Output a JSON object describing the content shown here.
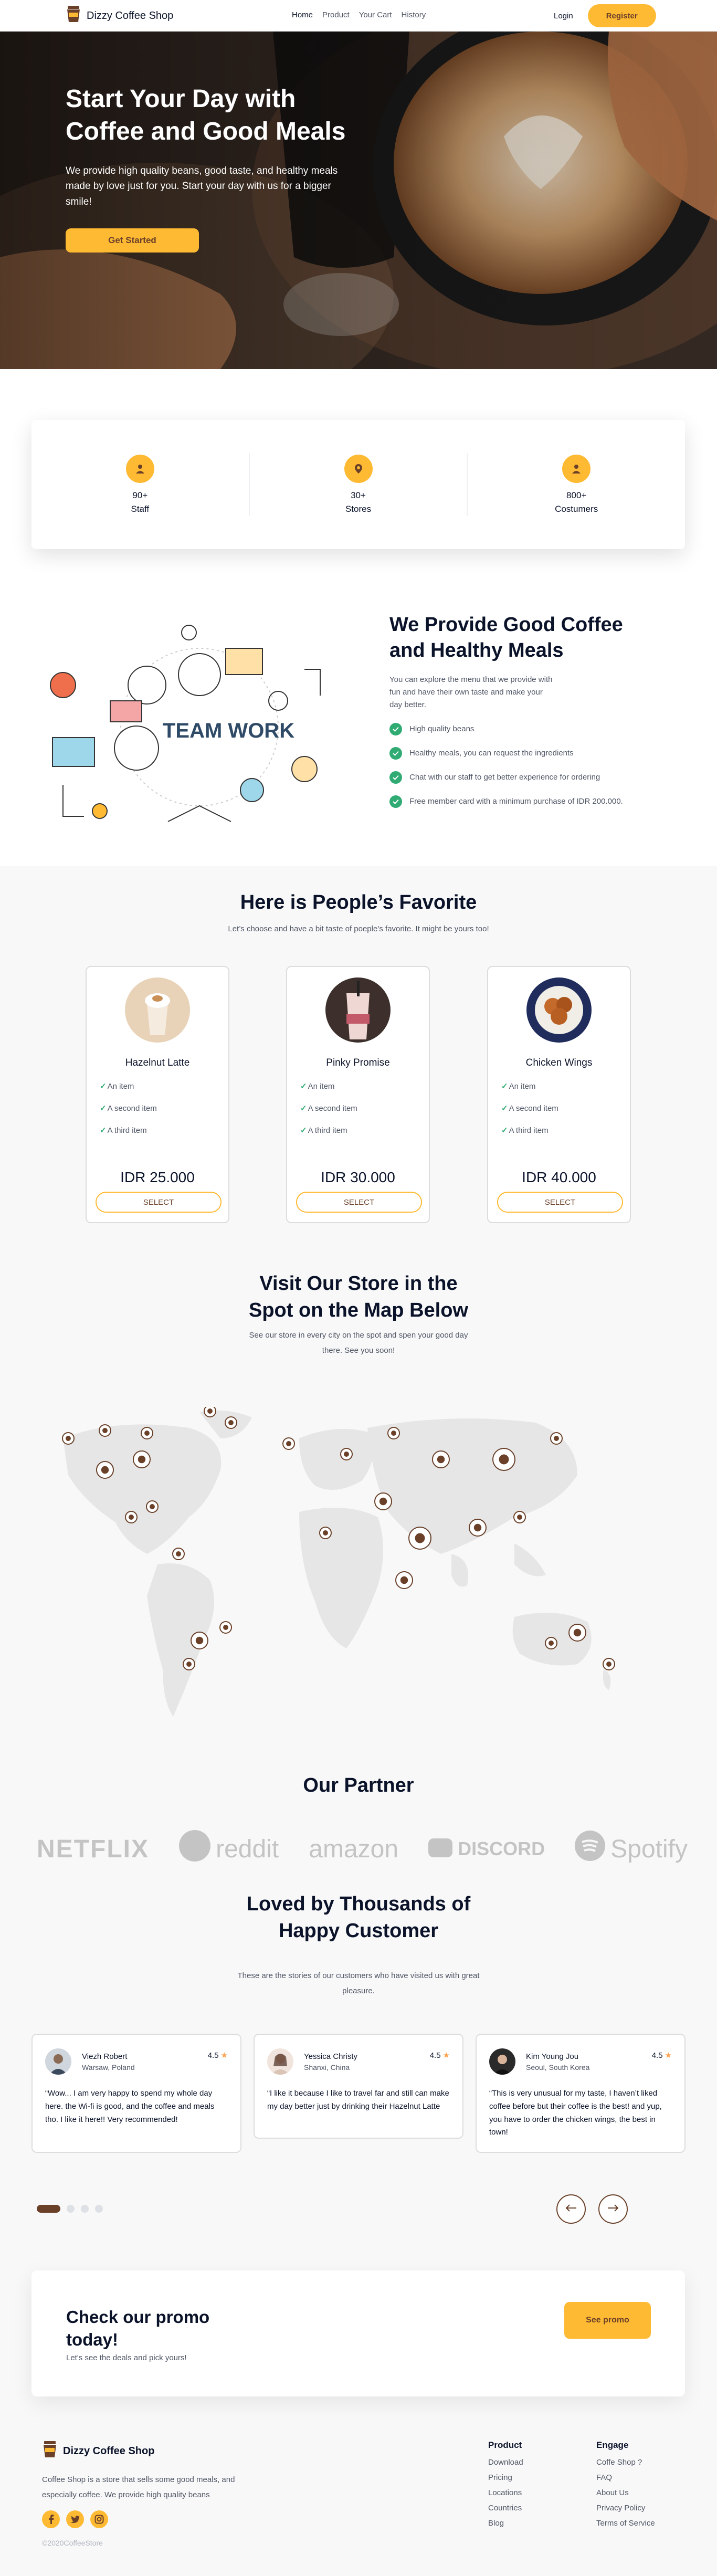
{
  "nav": {
    "brand": "Dizzy Coffee Shop",
    "links": [
      "Home",
      "Product",
      "Your Cart",
      "History"
    ],
    "login": "Login",
    "register": "Register"
  },
  "hero": {
    "title": "Start Your Day with Coffee and Good Meals",
    "subtitle": "We provide high quality beans, good taste, and healthy meals made by love just for you. Start your day with us for a bigger smile!",
    "cta": "Get Started"
  },
  "stats": [
    {
      "value": "90+",
      "label": "Staff",
      "icon": "user-icon"
    },
    {
      "value": "30+",
      "label": "Stores",
      "icon": "location-pin-icon"
    },
    {
      "value": "800+",
      "label": "Costumers",
      "icon": "heart-icon"
    }
  ],
  "about": {
    "illustration_text": "TEAM WORK",
    "title": "We Provide Good Coffee and Healthy Meals",
    "description": "You can explore the menu that we provide with fun and have their own taste and make your day better.",
    "points": [
      "High quality beans",
      "Healthy meals, you can request the ingredients",
      "Chat with our staff to get better experience for ordering",
      "Free member card with a minimum purchase of IDR 200.000."
    ]
  },
  "favorite": {
    "title": "Here is People’s Favorite",
    "subtitle": "Let’s choose and have a bit taste of poeple’s favorite. It might be yours too!",
    "products": [
      {
        "name": "Hazelnut Latte",
        "features": [
          "An item",
          "A second item",
          "A third item"
        ],
        "price": "IDR 25.000",
        "button": "SELECT"
      },
      {
        "name": "Pinky Promise",
        "features": [
          "An item",
          "A second item",
          "A third item"
        ],
        "price": "IDR 30.000",
        "button": "SELECT"
      },
      {
        "name": "Chicken Wings",
        "features": [
          "An item",
          "A second item",
          "A third item"
        ],
        "price": "IDR 40.000",
        "button": "SELECT"
      }
    ]
  },
  "map": {
    "title": "Visit Our Store in the Spot on the Map Below",
    "subtitle": "See our store in every city on the spot and spen your good day there. See you soon!"
  },
  "partner": {
    "title": "Our Partner",
    "logos": [
      "NETFLIX",
      "reddit",
      "amazon",
      "DISCORD",
      "Spotify"
    ]
  },
  "testimonials": {
    "title": "Loved by Thousands of Happy Customer",
    "subtitle": "These are the stories of our customers who have visited us with great pleasure.",
    "items": [
      {
        "name": "Viezh Robert",
        "location": "Warsaw, Poland",
        "rating": "4.5",
        "text": "“Wow... I am very happy to spend my whole day here. the Wi-fi is good, and the coffee and meals tho. I like it here!! Very recommended!"
      },
      {
        "name": "Yessica Christy",
        "location": "Shanxi, China",
        "rating": "4.5",
        "text": "“I like it because I like to travel far and still can make my day better just by drinking their Hazelnut Latte"
      },
      {
        "name": "Kim Young Jou",
        "location": "Seoul, South Korea",
        "rating": "4.5",
        "text": "“This is very unusual for my taste, I haven’t liked coffee before but their coffee is the best! and yup, you have to order the chicken wings, the best in town!"
      }
    ]
  },
  "promo": {
    "title": "Check our promo today!",
    "subtitle": "Let's see the deals and pick yours!",
    "button": "See promo"
  },
  "footer": {
    "brand": "Dizzy Coffee Shop",
    "description": "Coffee Shop is a store that sells some good meals, and especially coffee. We provide high quality beans",
    "copyright": "©2020CoffeeStore",
    "columns": [
      {
        "title": "Product",
        "links": [
          "Download",
          "Pricing",
          "Locations",
          "Countries",
          "Blog"
        ]
      },
      {
        "title": "Engage",
        "links": [
          "Coffe Shop ?",
          "FAQ",
          "About Us",
          "Privacy Policy",
          "Terms of Service"
        ]
      }
    ]
  },
  "colors": {
    "accent": "#FFBA33",
    "brown": "#6A4029",
    "check": "#2FAB73"
  }
}
